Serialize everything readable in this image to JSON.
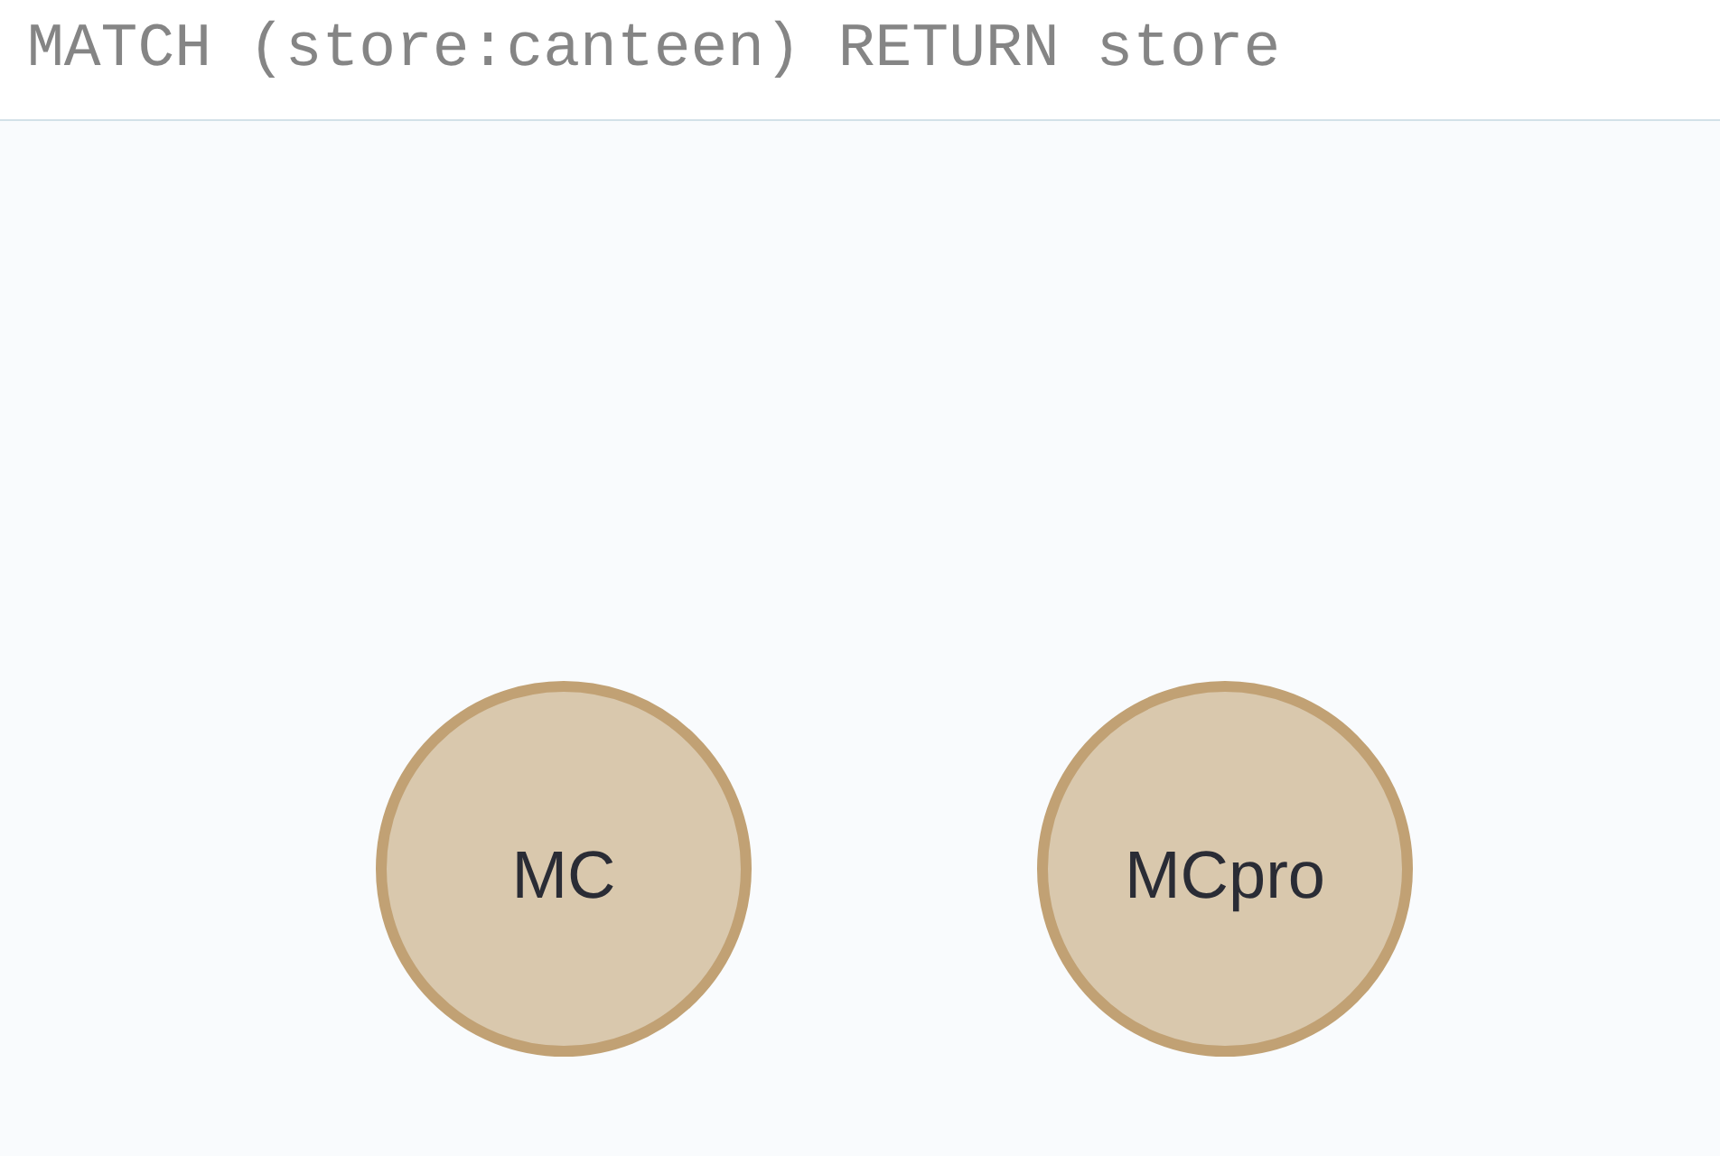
{
  "query_editor": {
    "value": "MATCH (store:canteen) RETURN store"
  },
  "graph": {
    "nodes": [
      {
        "caption": "MC"
      },
      {
        "caption": "MCpro"
      }
    ]
  }
}
